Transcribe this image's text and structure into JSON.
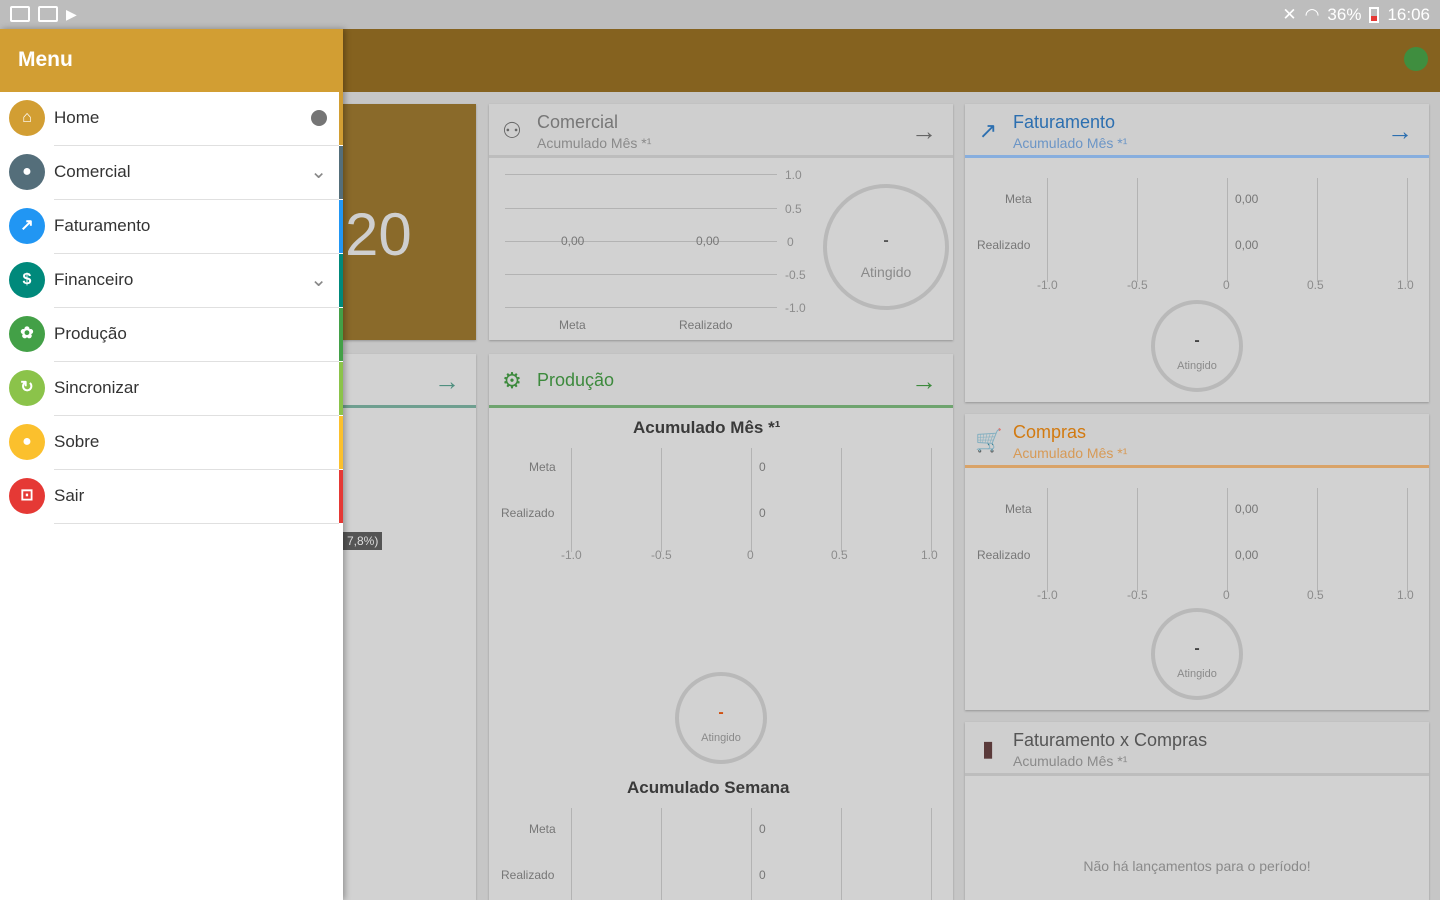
{
  "status_bar": {
    "battery": "36%",
    "time": "16:06"
  },
  "drawer": {
    "title": "Menu",
    "items": [
      {
        "label": "Home",
        "icon": "home-icon",
        "color": "#d29e33",
        "bar": "#d29e33",
        "indicator": "dot"
      },
      {
        "label": "Comercial",
        "icon": "user-badge-icon",
        "color": "#546e7a",
        "bar": "#546e7a",
        "indicator": "chevron"
      },
      {
        "label": "Faturamento",
        "icon": "trending-up-icon",
        "color": "#2196f3",
        "bar": "#2196f3",
        "indicator": ""
      },
      {
        "label": "Financeiro",
        "icon": "dollar-icon",
        "color": "#00897b",
        "bar": "#00897b",
        "indicator": "chevron"
      },
      {
        "label": "Produção",
        "icon": "gear-icon",
        "color": "#43a047",
        "bar": "#43a047",
        "indicator": ""
      },
      {
        "label": "Sincronizar",
        "icon": "sync-icon",
        "color": "#8bc34a",
        "bar": "#8bc34a",
        "indicator": ""
      },
      {
        "label": "Sobre",
        "icon": "info-icon",
        "color": "#fbc02d",
        "bar": "#fbc02d",
        "indicator": ""
      },
      {
        "label": "Sair",
        "icon": "exit-icon",
        "color": "#e53935",
        "bar": "#e53935",
        "indicator": ""
      }
    ]
  },
  "background": {
    "big_number": "20",
    "pct_badge": "7,8%)",
    "comercial": {
      "title": "Comercial",
      "subtitle": "Acumulado Mês *¹",
      "meta_value": "0,00",
      "realizado_value": "0,00",
      "x_labels": [
        "Meta",
        "Realizado"
      ],
      "y_ticks": [
        "1.0",
        "0.5",
        "0",
        "-0.5",
        "-1.0"
      ],
      "ring_value": "-",
      "ring_label": "Atingido"
    },
    "faturamento": {
      "title": "Faturamento",
      "subtitle": "Acumulado Mês *¹",
      "rows": [
        "Meta",
        "Realizado"
      ],
      "values": [
        "0,00",
        "0,00"
      ],
      "x_ticks": [
        "-1.0",
        "-0.5",
        "0",
        "0.5",
        "1.0"
      ],
      "ring_value": "-",
      "ring_label": "Atingido"
    },
    "producao": {
      "title": "Produção",
      "section1_title": "Acumulado Mês *¹",
      "section2_title": "Acumulado Semana",
      "rows": [
        "Meta",
        "Realizado"
      ],
      "values": [
        "0",
        "0"
      ],
      "x_ticks": [
        "-1.0",
        "-0.5",
        "0",
        "0.5",
        "1.0"
      ],
      "ring_value": "-",
      "ring_label": "Atingido"
    },
    "compras": {
      "title": "Compras",
      "subtitle": "Acumulado Mês *¹",
      "rows": [
        "Meta",
        "Realizado"
      ],
      "values": [
        "0,00",
        "0,00"
      ],
      "x_ticks": [
        "-1.0",
        "-0.5",
        "0",
        "0.5",
        "1.0"
      ],
      "ring_value": "-",
      "ring_label": "Atingido"
    },
    "fat_compras": {
      "title": "Faturamento x Compras",
      "subtitle": "Acumulado Mês *¹",
      "empty_text": "Não há lançamentos para o período!"
    }
  },
  "colors": {
    "drawer_header": "#d29e33",
    "appbar": "#85621f",
    "faturamento": "#2196f3",
    "producao": "#43a047",
    "compras": "#fb8c00"
  }
}
